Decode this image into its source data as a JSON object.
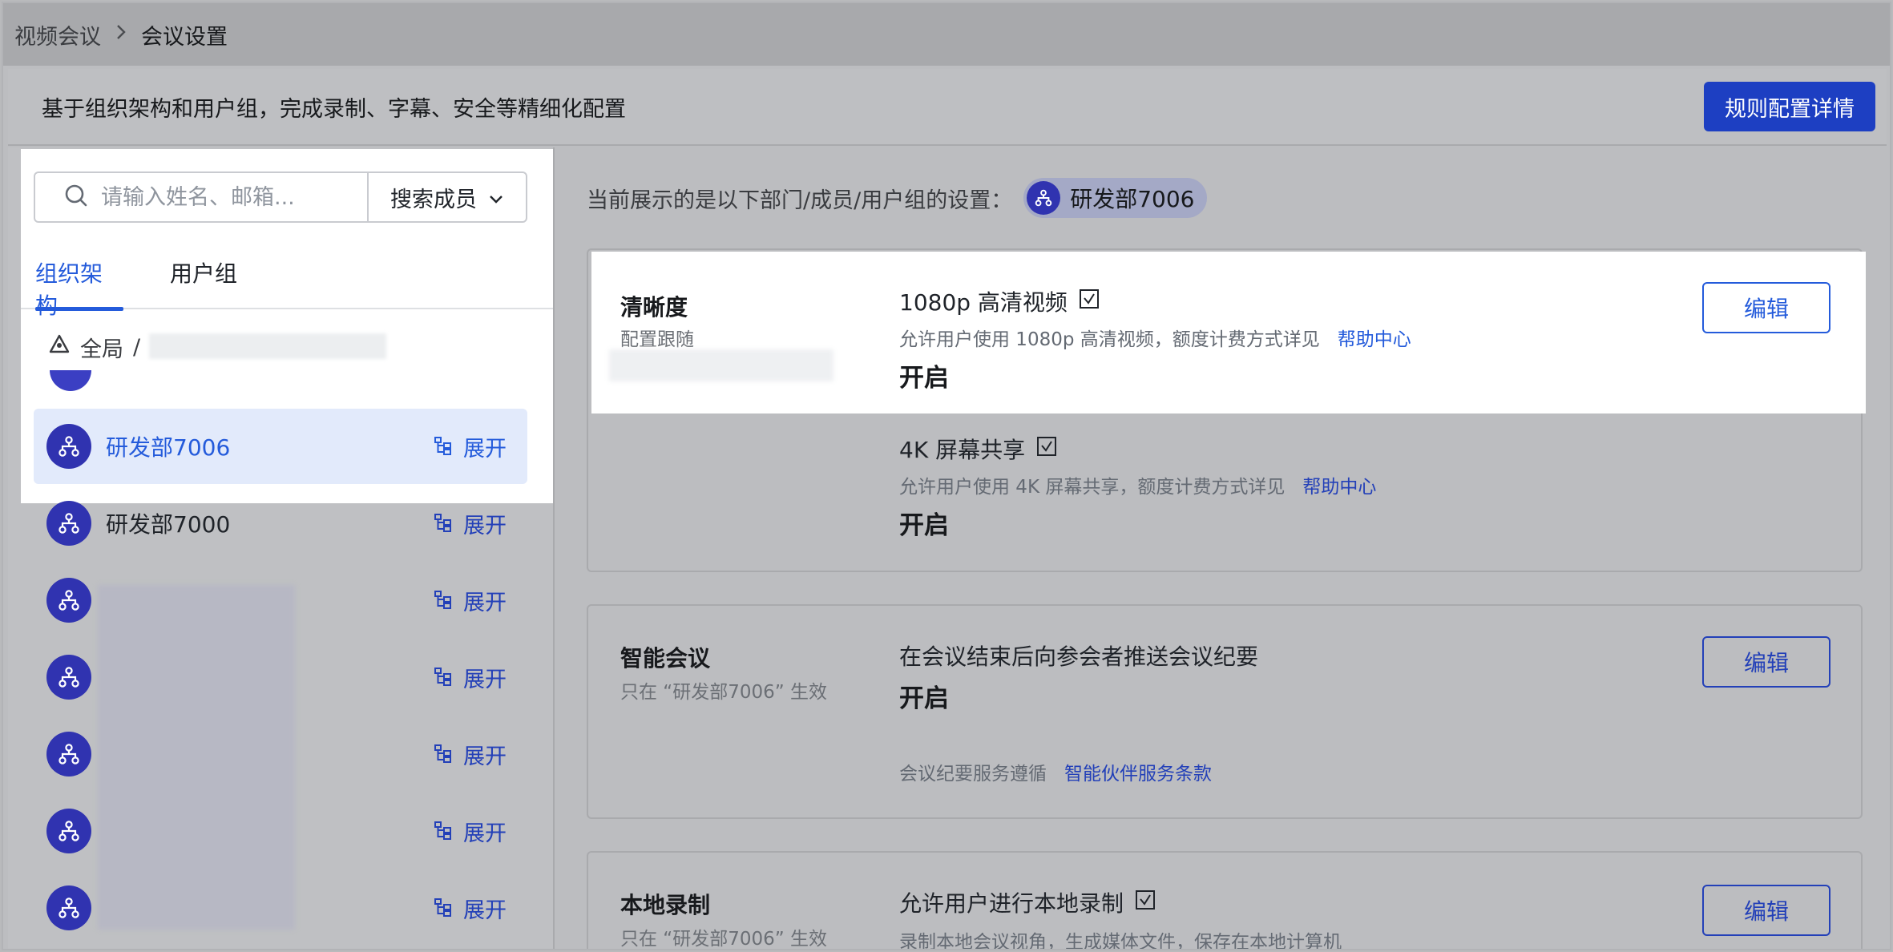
{
  "breadcrumb": {
    "parent": "视频会议",
    "current": "会议设置"
  },
  "banner": {
    "text": "基于组织架构和用户组，完成录制、字幕、安全等精细化配置",
    "button_label": "规则配置详情"
  },
  "search": {
    "placeholder": "请输入姓名、邮箱...",
    "mode_label": "搜索成员"
  },
  "tabs": [
    {
      "label": "组织架构",
      "active": true
    },
    {
      "label": "用户组",
      "active": false
    }
  ],
  "scope": {
    "label": "全局",
    "separator": "/"
  },
  "org_items": [
    {
      "name": "研发部7006",
      "expand_label": "展开",
      "selected": true
    },
    {
      "name": "研发部7000",
      "expand_label": "展开",
      "selected": false
    },
    {
      "name": "",
      "expand_label": "展开",
      "selected": false
    },
    {
      "name": "",
      "expand_label": "展开",
      "selected": false
    },
    {
      "name": "",
      "expand_label": "展开",
      "selected": false
    },
    {
      "name": "",
      "expand_label": "展开",
      "selected": false
    },
    {
      "name": "",
      "expand_label": "展开",
      "selected": false
    }
  ],
  "current_display": {
    "text": "当前展示的是以下部门/成员/用户组的设置：",
    "chip_label": "研发部7006"
  },
  "cards": [
    {
      "title": "清晰度",
      "subtitle": "配置跟随",
      "edit_label": "编辑",
      "features": [
        {
          "title": "1080p 高清视频",
          "desc": "允许用户使用 1080p 高清视频，额度计费方式详见",
          "link": "帮助中心",
          "status": "开启"
        },
        {
          "title": "4K 屏幕共享",
          "desc": "允许用户使用 4K 屏幕共享，额度计费方式详见",
          "link": "帮助中心",
          "status": "开启"
        }
      ]
    },
    {
      "title": "智能会议",
      "subtitle": "只在 “研发部7006” 生效",
      "edit_label": "编辑",
      "features": [
        {
          "title": "在会议结束后向参会者推送会议纪要",
          "status": "开启"
        }
      ],
      "footnote": {
        "text": "会议纪要服务遵循",
        "link": "智能伙伴服务条款"
      }
    },
    {
      "title": "本地录制",
      "subtitle": "只在 “研发部7006” 生效",
      "edit_label": "编辑",
      "features": [
        {
          "title": "允许用户进行本地录制",
          "desc": "录制本地会议视角，生成媒体文件，保存在本地计算机"
        }
      ]
    }
  ],
  "colors": {
    "accent": "#245bdb",
    "primary_button": "#1d3fc2",
    "avatar": "#3033b0",
    "selected_row": "#e2eafb"
  }
}
